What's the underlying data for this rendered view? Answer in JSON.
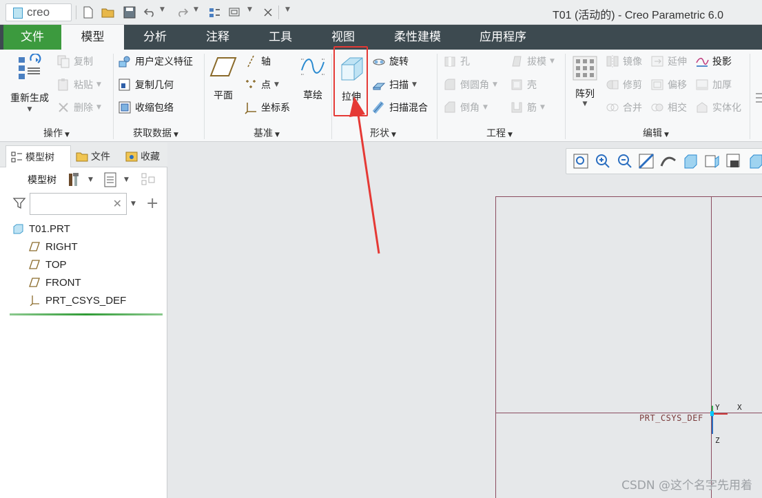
{
  "app": {
    "logo_text": "creo",
    "window_title": "T01 (活动的) - Creo Parametric 6.0"
  },
  "tabs": [
    {
      "label": "文件"
    },
    {
      "label": "模型"
    },
    {
      "label": "分析"
    },
    {
      "label": "注释"
    },
    {
      "label": "工具"
    },
    {
      "label": "视图"
    },
    {
      "label": "柔性建模"
    },
    {
      "label": "应用程序"
    }
  ],
  "ribbon": {
    "groups": {
      "operation": {
        "label": "操作",
        "regenerate": "重新生成",
        "copy": "复制",
        "paste": "粘贴",
        "delete": "删除"
      },
      "get_data": {
        "label": "获取数据",
        "udf": "用户定义特征",
        "copy_geom": "复制几何",
        "shrinkwrap": "收缩包络"
      },
      "datum": {
        "label": "基准",
        "plane": "平面",
        "axis": "轴",
        "point": "点",
        "csys": "坐标系",
        "sketch": "草绘"
      },
      "shapes": {
        "label": "形状",
        "extrude": "拉伸",
        "revolve": "旋转",
        "sweep": "扫描",
        "swept_blend": "扫描混合"
      },
      "engineering": {
        "label": "工程",
        "hole": "孔",
        "round": "倒圆角",
        "chamfer": "倒角",
        "draft": "拔模",
        "shell": "壳",
        "rib": "筋"
      },
      "editing": {
        "label": "编辑",
        "pattern": "阵列",
        "mirror": "镜像",
        "extend": "延伸",
        "project": "投影",
        "trim": "修剪",
        "offset": "偏移",
        "thicken": "加厚",
        "merge": "合并",
        "intersect": "相交",
        "solidify": "实体化"
      }
    }
  },
  "panel": {
    "tabs": [
      {
        "label": "模型树"
      },
      {
        "label": "文件"
      },
      {
        "label": "收藏"
      }
    ],
    "tree_menu_label": "模型树",
    "search_value": "",
    "tree": [
      {
        "label": "T01.PRT"
      },
      {
        "label": "RIGHT"
      },
      {
        "label": "TOP"
      },
      {
        "label": "FRONT"
      },
      {
        "label": "PRT_CSYS_DEF"
      }
    ]
  },
  "graphics": {
    "csys_label": "PRT_CSYS_DEF",
    "axis_y": "Y",
    "axis_x": "X",
    "axis_z": "Z"
  },
  "watermark": "CSDN @这个名字先用着",
  "colors": {
    "file_tab": "#3c9a3e",
    "tabbar": "#3d4a50",
    "highlight": "#e53935",
    "plane_edge": "#8a4a5e"
  }
}
